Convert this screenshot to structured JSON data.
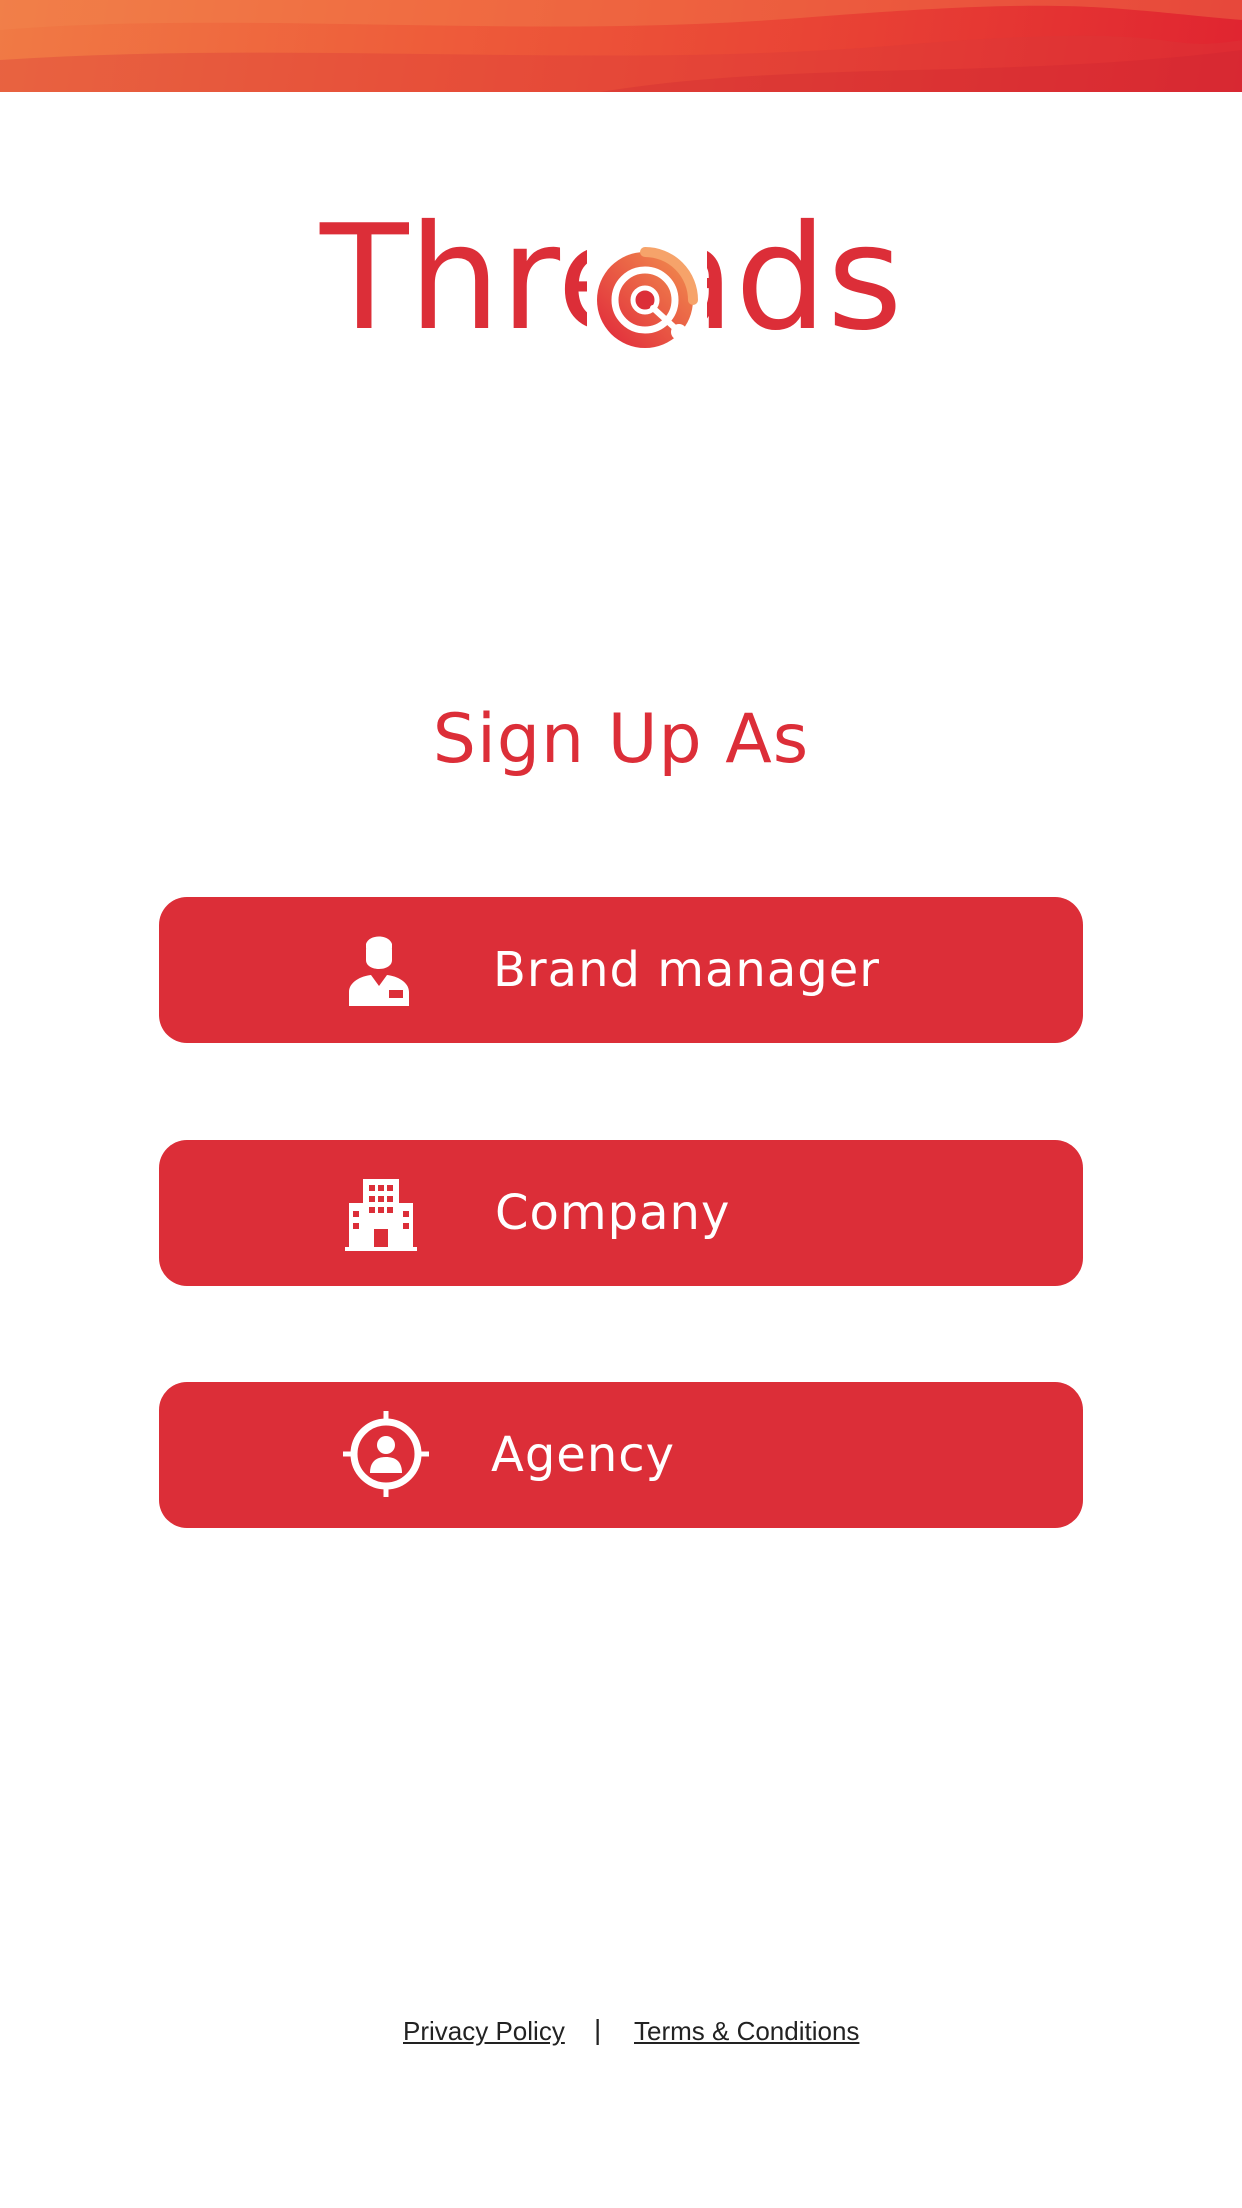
{
  "app": {
    "logo_text": "Threads"
  },
  "page": {
    "title": "Sign Up As"
  },
  "roles": [
    {
      "label": "Brand manager",
      "icon": "brand-manager-icon"
    },
    {
      "label": "Company",
      "icon": "building-icon"
    },
    {
      "label": "Agency",
      "icon": "target-user-icon"
    }
  ],
  "footer": {
    "privacy_label": "Privacy Policy",
    "separator": "|",
    "terms_label": "Terms & Conditions"
  },
  "colors": {
    "accent": "#dc2e38",
    "header_gradient_start": "#f07a45",
    "header_gradient_end": "#e02430",
    "button_text": "#ffffff"
  }
}
